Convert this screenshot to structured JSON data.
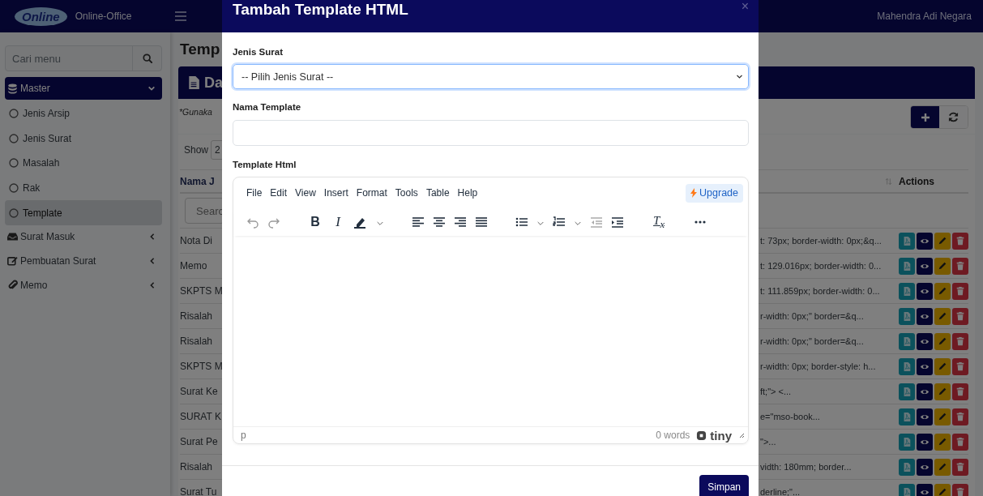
{
  "navbar": {
    "logo_text": "Online",
    "brand": "Online-Office",
    "user": "Mahendra Adi Negara"
  },
  "sidebar": {
    "search_placeholder": "Cari menu",
    "items": [
      {
        "label": "Master",
        "selected": true,
        "expanded": true,
        "children": [
          {
            "label": "Jenis Arsip",
            "selected": false
          },
          {
            "label": "Jenis Surat",
            "selected": false
          },
          {
            "label": "Masalah",
            "selected": false
          },
          {
            "label": "Rak",
            "selected": false
          },
          {
            "label": "Template",
            "selected": true
          }
        ]
      },
      {
        "label": "Surat Masuk",
        "selected": false,
        "expanded": false
      },
      {
        "label": "Pembuatan Surat",
        "selected": false,
        "expanded": false
      },
      {
        "label": "Memo",
        "selected": false,
        "expanded": false
      }
    ]
  },
  "page": {
    "title": "Temp",
    "card_title": "Da",
    "note": "*Gunaka",
    "show_label": "Show",
    "show_value": "2",
    "columns": [
      "Nama J",
      "Actions"
    ],
    "search_placeholder": "Searc",
    "rows": [
      {
        "name": "Nota Di",
        "content": "t: 73px; border-width: 0px;&q..."
      },
      {
        "name": "Memo",
        "content": "t: 129.016px; border-width: 0..."
      },
      {
        "name": "SKPTS M",
        "content": "t: 111.859px; border-width: 0..."
      },
      {
        "name": "Risalah",
        "content": "r-width: 0px;\" border=&q..."
      },
      {
        "name": "Risalah",
        "content": "r-width: 0px;\" border=&q..."
      },
      {
        "name": "SKPTS M",
        "content": "r-width: 0px; border-style: h..."
      },
      {
        "name": "Surat Ke",
        "content": "ft;\"> <..."
      },
      {
        "name": "SURAT K",
        "content": "e=\"mso-book..."
      },
      {
        "name": "Surat Pe",
        "content": "\">..."
      },
      {
        "name": "Risalah",
        "content": "vidth: 180mm; border..."
      },
      {
        "name": "Surat Tu",
        "content": "derline;\"..."
      }
    ]
  },
  "modal": {
    "title": "Tambah Template HTML",
    "close": "×",
    "fields": [
      {
        "label": "Jenis Surat",
        "kind": "select",
        "value": "-- Pilih Jenis Surat --"
      },
      {
        "label": "Nama Template",
        "kind": "text"
      },
      {
        "label": "Template Html",
        "kind": "editor"
      }
    ],
    "editor": {
      "menu": [
        "File",
        "Edit",
        "View",
        "Insert",
        "Format",
        "Tools",
        "Table",
        "Help"
      ],
      "upgrade": "Upgrade",
      "bold": "B",
      "italic": "I",
      "clear_format": "T$_{x}$",
      "path": "p",
      "word_count": "0 words",
      "brand": "tiny"
    },
    "submit": "Simpan"
  }
}
